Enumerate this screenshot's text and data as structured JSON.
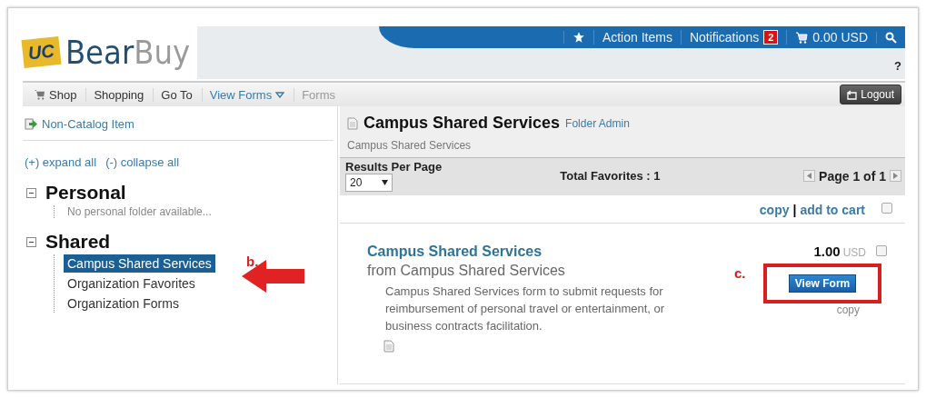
{
  "logo": {
    "mark": "UC",
    "wordmark": "BearBuy"
  },
  "top_bar": {
    "action_items": "Action Items",
    "notifications": "Notifications",
    "notification_count": "2",
    "cart_total": "0.00 USD",
    "help": "?"
  },
  "breadcrumbs": [
    {
      "label": "Shop",
      "kind": "cart"
    },
    {
      "label": "Shopping",
      "kind": "link"
    },
    {
      "label": "Go To",
      "kind": "link"
    },
    {
      "label": "View Forms",
      "kind": "dropdown"
    },
    {
      "label": "Forms",
      "kind": "current"
    }
  ],
  "logout": "Logout",
  "sidebar": {
    "non_catalog": "Non-Catalog Item",
    "expand_all": "(+) expand all",
    "collapse_all": "(-) collapse all",
    "folders": [
      {
        "label": "Personal",
        "expanded": true,
        "empty_note": "No personal folder available..."
      },
      {
        "label": "Shared",
        "expanded": true,
        "children": [
          {
            "label": "Campus Shared Services",
            "selected": true
          },
          {
            "label": "Organization Favorites",
            "selected": false
          },
          {
            "label": "Organization Forms",
            "selected": false
          }
        ]
      }
    ]
  },
  "main": {
    "title": "Campus Shared Services",
    "title_link": "Folder Admin",
    "subtitle": "Campus Shared Services",
    "results_per_page_label": "Results Per Page",
    "results_per_page": "20",
    "total": "Total Favorites : 1",
    "page": "Page 1 of 1",
    "copy": "copy",
    "separator": "|",
    "add_to_cart": "add to cart",
    "select_all_checked": false,
    "items": [
      {
        "title": "Campus Shared Services",
        "supplier": "from Campus Shared Services",
        "description": "Campus Shared Services form to submit requests for reimbursement of personal travel or entertainment, or business contracts facilitation.",
        "price": "1.00",
        "currency": "USD",
        "checked": false,
        "button": "View Form",
        "copy": "copy"
      }
    ]
  },
  "annotations": [
    {
      "label": "b.",
      "kind": "arrow"
    },
    {
      "label": "c.",
      "kind": "box"
    }
  ]
}
